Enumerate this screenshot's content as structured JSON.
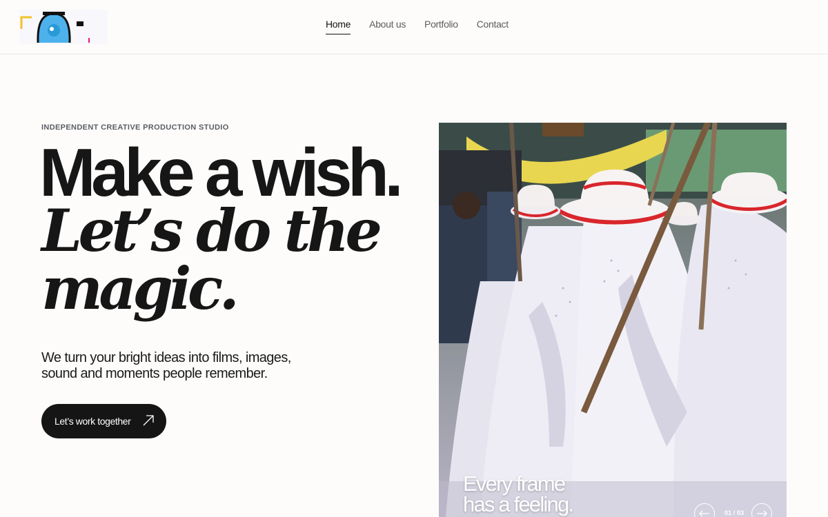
{
  "brand": {
    "logo_icon": "camera-logo-icon",
    "accent_colors": [
      "#f2c12e",
      "#4db1ec",
      "#e5197d",
      "#111111"
    ]
  },
  "nav": {
    "items": [
      {
        "label": "Home",
        "active": true
      },
      {
        "label": "About us",
        "active": false
      },
      {
        "label": "Portfolio",
        "active": false
      },
      {
        "label": "Contact",
        "active": false
      }
    ]
  },
  "hero": {
    "eyebrow": "INDEPENDENT CREATIVE PRODUCTION STUDIO",
    "headline_line1": "Make a wish.",
    "headline_line2": "Let’s do the",
    "headline_line3": "magic.",
    "lede_line1": "We turn your bright ideas into films, images,",
    "lede_line2": "sound and moments people remember.",
    "cta_label": "Let’s work together",
    "cta_icon": "arrow-up-right-icon"
  },
  "slider": {
    "caption_line1": "Every frame",
    "caption_line2": "has a feeling.",
    "counter": "01 / 03",
    "prev_icon": "arrow-left-icon",
    "next_icon": "arrow-right-icon"
  },
  "colors": {
    "background": "#fdfcfa",
    "text": "#141414",
    "button": "#151515",
    "muted": "#5c5c5c"
  }
}
